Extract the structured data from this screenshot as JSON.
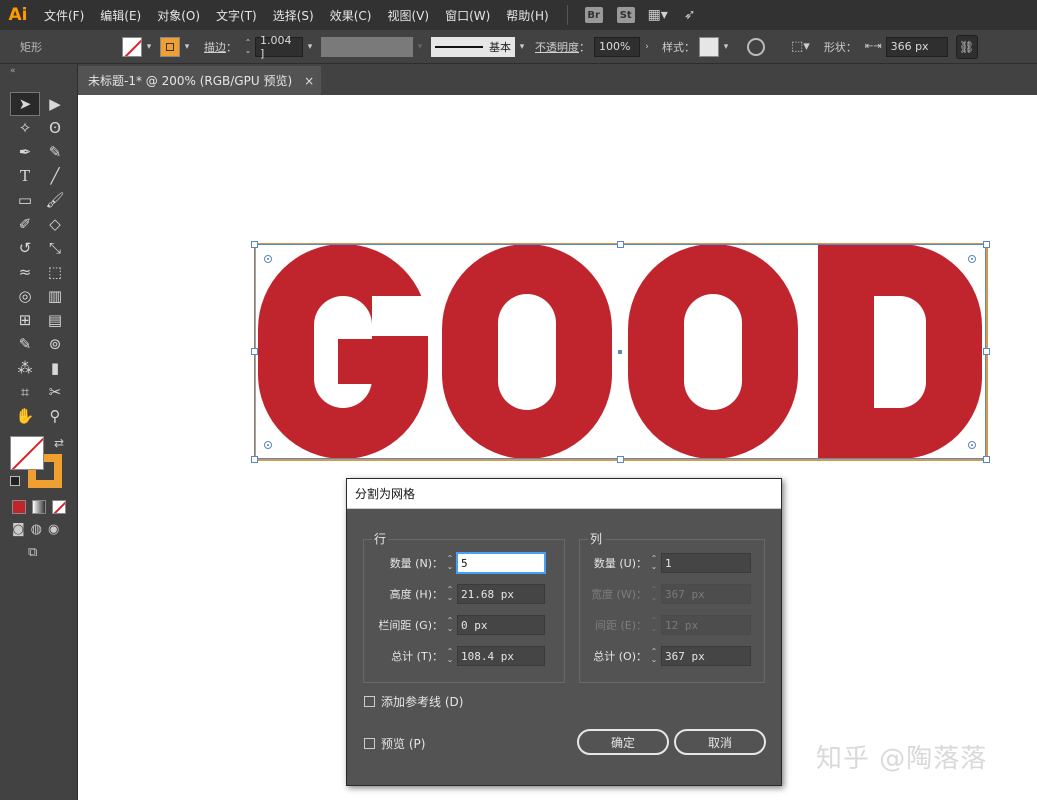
{
  "app": {
    "logo": "Ai"
  },
  "menu": {
    "items": [
      "文件(F)",
      "编辑(E)",
      "对象(O)",
      "文字(T)",
      "选择(S)",
      "效果(C)",
      "视图(V)",
      "窗口(W)",
      "帮助(H)"
    ],
    "icons": {
      "bridge": "Br",
      "stock": "St"
    }
  },
  "control_bar": {
    "object_type": "矩形",
    "stroke_label": "描边",
    "stroke_weight": "1.004 ]",
    "stroke_style": "基本",
    "opacity_label": "不透明度",
    "opacity_value": "100%",
    "style_label": "样式",
    "shape_label": "形状",
    "shape_width": "366 px"
  },
  "document_tab": {
    "title": "未标题-1* @ 200% (RGB/GPU 预览)",
    "close": "×"
  },
  "artwork": {
    "text": "GOOD",
    "color": "#c0252e"
  },
  "dialog": {
    "title": "分割为网格",
    "rows": {
      "label": "行",
      "number_label": "数量 (N)：",
      "number_value": "5",
      "height_label": "高度 (H)：",
      "height_value": "21.68 px",
      "gutter_label": "栏间距 (G)：",
      "gutter_value": "0 px",
      "total_label": "总计 (T)：",
      "total_value": "108.4 px"
    },
    "columns": {
      "label": "列",
      "number_label": "数量 (U)：",
      "number_value": "1",
      "width_label": "宽度 (W)：",
      "width_value": "367 px",
      "gutter_label": "间距 (E)：",
      "gutter_value": "12 px",
      "total_label": "总计 (O)：",
      "total_value": "367 px"
    },
    "add_guides_label": "添加参考线 (D)",
    "preview_label": "预览 (P)",
    "ok_label": "确定",
    "cancel_label": "取消"
  },
  "watermark": "知乎 @陶落落"
}
